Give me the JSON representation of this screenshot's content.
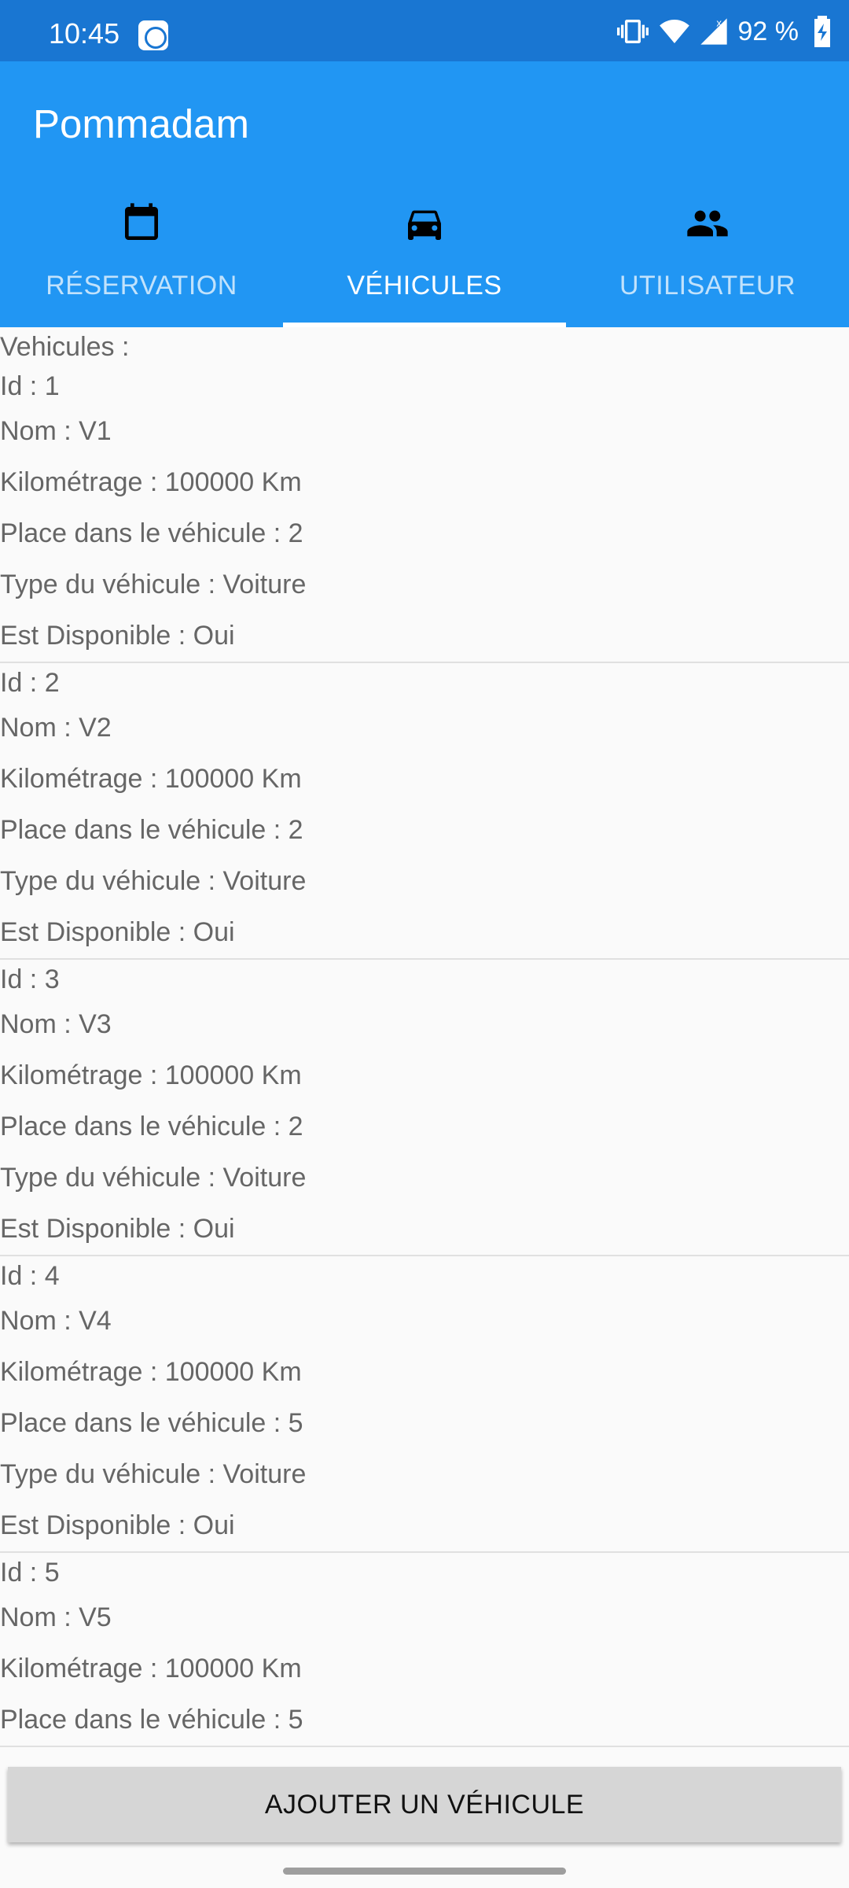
{
  "status_bar": {
    "time": "10:45",
    "battery_text": "92 %",
    "notification_icon": "app-notification-icon",
    "icons": [
      "vibrate-icon",
      "wifi-icon",
      "signal-icon",
      "battery-charging-icon"
    ]
  },
  "app": {
    "title": "Pommadam"
  },
  "tabs": [
    {
      "label": "RÉSERVATION",
      "icon": "calendar-icon",
      "active": false
    },
    {
      "label": "VÉHICULES",
      "icon": "car-icon",
      "active": true
    },
    {
      "label": "UTILISATEUR",
      "icon": "people-icon",
      "active": false
    }
  ],
  "content": {
    "header": "Vehicules :",
    "vehicles": [
      {
        "fields": [
          "Id : 1",
          "Nom : V1",
          "Kilométrage : 100000 Km",
          "Place dans le véhicule : 2",
          "Type du véhicule : Voiture",
          "Est Disponible : Oui"
        ]
      },
      {
        "fields": [
          "Id : 2",
          "Nom : V2",
          "Kilométrage : 100000 Km",
          "Place dans le véhicule : 2",
          "Type du véhicule : Voiture",
          "Est Disponible : Oui"
        ]
      },
      {
        "fields": [
          "Id : 3",
          "Nom : V3",
          "Kilométrage : 100000 Km",
          "Place dans le véhicule : 2",
          "Type du véhicule : Voiture",
          "Est Disponible : Oui"
        ]
      },
      {
        "fields": [
          "Id : 4",
          "Nom : V4",
          "Kilométrage : 100000 Km",
          "Place dans le véhicule : 5",
          "Type du véhicule : Voiture",
          "Est Disponible : Oui"
        ]
      },
      {
        "fields": [
          "Id : 5",
          "Nom : V5",
          "Kilométrage : 100000 Km",
          "Place dans le véhicule : 5"
        ]
      }
    ]
  },
  "add_button": {
    "label": "AJOUTER UN VÉHICULE"
  },
  "colors": {
    "status_bar": "#1976d2",
    "app_bar": "#2196f3",
    "background": "#fafafa",
    "text": "#666666",
    "button": "#d6d6d6"
  }
}
